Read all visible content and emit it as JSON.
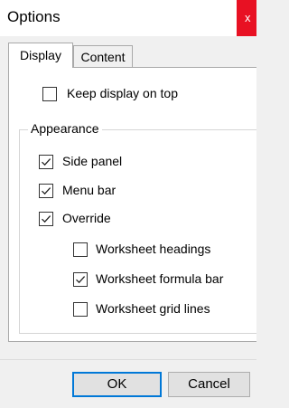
{
  "window": {
    "title": "Options",
    "close_label": "x"
  },
  "tabs": [
    {
      "label": "Display",
      "active": true
    },
    {
      "label": "Content",
      "active": false
    }
  ],
  "options": {
    "keep_on_top": {
      "label": "Keep display on top",
      "checked": false
    },
    "appearance_group": "Appearance",
    "side_panel": {
      "label": "Side panel",
      "checked": true
    },
    "menu_bar": {
      "label": "Menu bar",
      "checked": true
    },
    "override": {
      "label": "Override",
      "checked": true
    },
    "worksheet_headings": {
      "label": "Worksheet headings",
      "checked": false
    },
    "worksheet_formula_bar": {
      "label": "Worksheet formula bar",
      "checked": true
    },
    "worksheet_grid_lines": {
      "label": "Worksheet grid lines",
      "checked": false
    }
  },
  "buttons": {
    "ok": "OK",
    "cancel": "Cancel"
  }
}
